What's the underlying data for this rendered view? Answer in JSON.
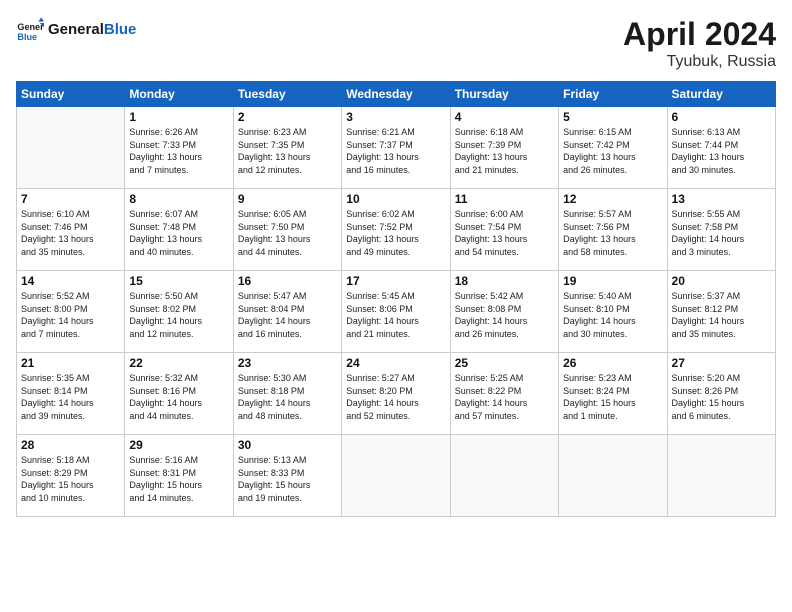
{
  "header": {
    "logo_general": "General",
    "logo_blue": "Blue",
    "month_year": "April 2024",
    "location": "Tyubuk, Russia"
  },
  "weekdays": [
    "Sunday",
    "Monday",
    "Tuesday",
    "Wednesday",
    "Thursday",
    "Friday",
    "Saturday"
  ],
  "weeks": [
    [
      {
        "day": "",
        "info": ""
      },
      {
        "day": "1",
        "info": "Sunrise: 6:26 AM\nSunset: 7:33 PM\nDaylight: 13 hours\nand 7 minutes."
      },
      {
        "day": "2",
        "info": "Sunrise: 6:23 AM\nSunset: 7:35 PM\nDaylight: 13 hours\nand 12 minutes."
      },
      {
        "day": "3",
        "info": "Sunrise: 6:21 AM\nSunset: 7:37 PM\nDaylight: 13 hours\nand 16 minutes."
      },
      {
        "day": "4",
        "info": "Sunrise: 6:18 AM\nSunset: 7:39 PM\nDaylight: 13 hours\nand 21 minutes."
      },
      {
        "day": "5",
        "info": "Sunrise: 6:15 AM\nSunset: 7:42 PM\nDaylight: 13 hours\nand 26 minutes."
      },
      {
        "day": "6",
        "info": "Sunrise: 6:13 AM\nSunset: 7:44 PM\nDaylight: 13 hours\nand 30 minutes."
      }
    ],
    [
      {
        "day": "7",
        "info": "Sunrise: 6:10 AM\nSunset: 7:46 PM\nDaylight: 13 hours\nand 35 minutes."
      },
      {
        "day": "8",
        "info": "Sunrise: 6:07 AM\nSunset: 7:48 PM\nDaylight: 13 hours\nand 40 minutes."
      },
      {
        "day": "9",
        "info": "Sunrise: 6:05 AM\nSunset: 7:50 PM\nDaylight: 13 hours\nand 44 minutes."
      },
      {
        "day": "10",
        "info": "Sunrise: 6:02 AM\nSunset: 7:52 PM\nDaylight: 13 hours\nand 49 minutes."
      },
      {
        "day": "11",
        "info": "Sunrise: 6:00 AM\nSunset: 7:54 PM\nDaylight: 13 hours\nand 54 minutes."
      },
      {
        "day": "12",
        "info": "Sunrise: 5:57 AM\nSunset: 7:56 PM\nDaylight: 13 hours\nand 58 minutes."
      },
      {
        "day": "13",
        "info": "Sunrise: 5:55 AM\nSunset: 7:58 PM\nDaylight: 14 hours\nand 3 minutes."
      }
    ],
    [
      {
        "day": "14",
        "info": "Sunrise: 5:52 AM\nSunset: 8:00 PM\nDaylight: 14 hours\nand 7 minutes."
      },
      {
        "day": "15",
        "info": "Sunrise: 5:50 AM\nSunset: 8:02 PM\nDaylight: 14 hours\nand 12 minutes."
      },
      {
        "day": "16",
        "info": "Sunrise: 5:47 AM\nSunset: 8:04 PM\nDaylight: 14 hours\nand 16 minutes."
      },
      {
        "day": "17",
        "info": "Sunrise: 5:45 AM\nSunset: 8:06 PM\nDaylight: 14 hours\nand 21 minutes."
      },
      {
        "day": "18",
        "info": "Sunrise: 5:42 AM\nSunset: 8:08 PM\nDaylight: 14 hours\nand 26 minutes."
      },
      {
        "day": "19",
        "info": "Sunrise: 5:40 AM\nSunset: 8:10 PM\nDaylight: 14 hours\nand 30 minutes."
      },
      {
        "day": "20",
        "info": "Sunrise: 5:37 AM\nSunset: 8:12 PM\nDaylight: 14 hours\nand 35 minutes."
      }
    ],
    [
      {
        "day": "21",
        "info": "Sunrise: 5:35 AM\nSunset: 8:14 PM\nDaylight: 14 hours\nand 39 minutes."
      },
      {
        "day": "22",
        "info": "Sunrise: 5:32 AM\nSunset: 8:16 PM\nDaylight: 14 hours\nand 44 minutes."
      },
      {
        "day": "23",
        "info": "Sunrise: 5:30 AM\nSunset: 8:18 PM\nDaylight: 14 hours\nand 48 minutes."
      },
      {
        "day": "24",
        "info": "Sunrise: 5:27 AM\nSunset: 8:20 PM\nDaylight: 14 hours\nand 52 minutes."
      },
      {
        "day": "25",
        "info": "Sunrise: 5:25 AM\nSunset: 8:22 PM\nDaylight: 14 hours\nand 57 minutes."
      },
      {
        "day": "26",
        "info": "Sunrise: 5:23 AM\nSunset: 8:24 PM\nDaylight: 15 hours\nand 1 minute."
      },
      {
        "day": "27",
        "info": "Sunrise: 5:20 AM\nSunset: 8:26 PM\nDaylight: 15 hours\nand 6 minutes."
      }
    ],
    [
      {
        "day": "28",
        "info": "Sunrise: 5:18 AM\nSunset: 8:29 PM\nDaylight: 15 hours\nand 10 minutes."
      },
      {
        "day": "29",
        "info": "Sunrise: 5:16 AM\nSunset: 8:31 PM\nDaylight: 15 hours\nand 14 minutes."
      },
      {
        "day": "30",
        "info": "Sunrise: 5:13 AM\nSunset: 8:33 PM\nDaylight: 15 hours\nand 19 minutes."
      },
      {
        "day": "",
        "info": ""
      },
      {
        "day": "",
        "info": ""
      },
      {
        "day": "",
        "info": ""
      },
      {
        "day": "",
        "info": ""
      }
    ]
  ]
}
